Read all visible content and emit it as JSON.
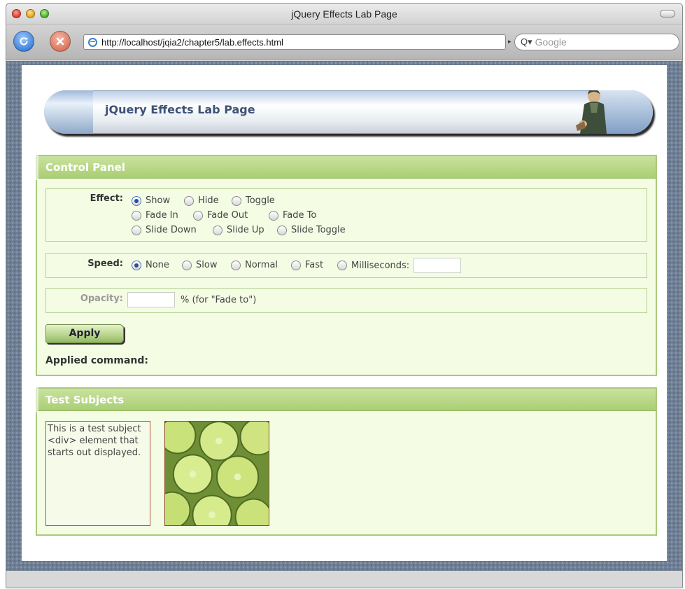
{
  "window": {
    "title": "jQuery Effects Lab Page"
  },
  "toolbar": {
    "url": "http://localhost/jqia2/chapter5/lab.effects.html",
    "search_placeholder": "Google"
  },
  "banner": {
    "title": "jQuery Effects Lab Page"
  },
  "control_panel": {
    "heading": "Control Panel",
    "effect": {
      "label": "Effect:",
      "options": [
        "Show",
        "Hide",
        "Toggle",
        "Fade In",
        "Fade Out",
        "Fade To",
        "Slide Down",
        "Slide Up",
        "Slide Toggle"
      ],
      "selected": "Show"
    },
    "speed": {
      "label": "Speed:",
      "options": [
        "None",
        "Slow",
        "Normal",
        "Fast",
        "Milliseconds:"
      ],
      "selected": "None",
      "milliseconds_value": ""
    },
    "opacity": {
      "label": "Opacity:",
      "value": "",
      "suffix": "% (for \"Fade to\")"
    },
    "apply_label": "Apply",
    "applied_command_label": "Applied command:"
  },
  "test_subjects": {
    "heading": "Test Subjects",
    "div_text": "This is a test subject <div> element that starts out displayed.",
    "image": "limes-image"
  },
  "colors": {
    "panel_header": "#a9ce74",
    "panel_background": "#f4fce4",
    "banner_text": "#3d5277"
  }
}
